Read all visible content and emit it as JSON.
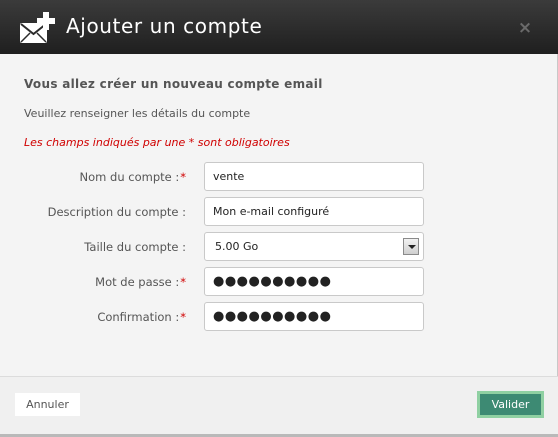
{
  "dialog": {
    "title": "Ajouter un compte",
    "title_icon": "mail-add-icon",
    "close_icon": "close-icon"
  },
  "content": {
    "heading": "Vous allez créer un nouveau compte email",
    "subheading": "Veuillez renseigner les détails du compte",
    "required_note": "Les champs indiqués par une * sont obligatoires"
  },
  "form": {
    "account_name": {
      "label": "Nom du compte :",
      "required": "*",
      "value": "vente"
    },
    "description": {
      "label": "Description du compte :",
      "value": "Mon e-mail configuré"
    },
    "size": {
      "label": "Taille du compte :",
      "value": "5.00 Go"
    },
    "password": {
      "label": "Mot de passe :",
      "required": "*",
      "value": "●●●●●●●●●●"
    },
    "confirmation": {
      "label": "Confirmation :",
      "required": "*",
      "value": "●●●●●●●●●●"
    }
  },
  "footer": {
    "cancel_label": "Annuler",
    "validate_label": "Valider"
  },
  "colors": {
    "titlebar": "#2a2a2a",
    "required": "#d00000",
    "validate_button": "#3d8a73",
    "validate_border": "#8fd0a2"
  }
}
